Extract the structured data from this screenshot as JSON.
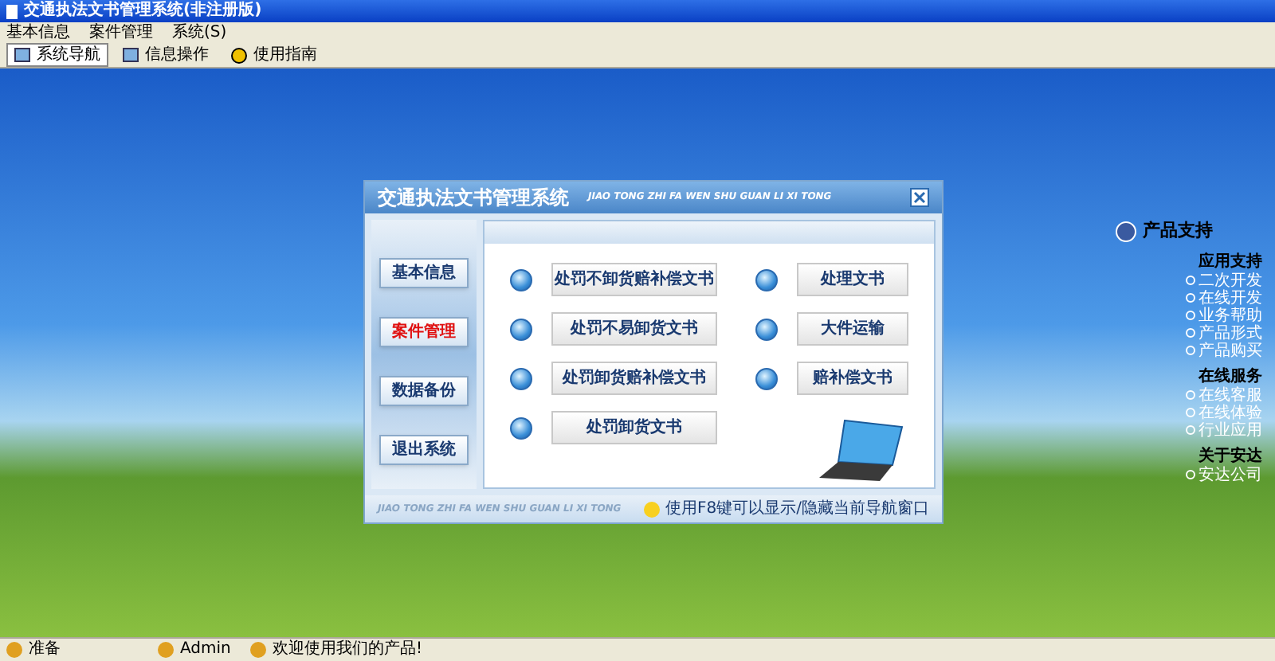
{
  "window": {
    "title": "交通执法文书管理系统(非注册版)"
  },
  "menu": [
    "基本信息",
    "案件管理",
    "系统(S)"
  ],
  "toolbar": [
    {
      "label": "系统导航",
      "selected": true
    },
    {
      "label": "信息操作",
      "selected": false
    },
    {
      "label": "使用指南",
      "selected": false
    }
  ],
  "dialog": {
    "title": "交通执法文书管理系统",
    "subtitle": "JIAO TONG ZHI FA WEN SHU GUAN LI XI TONG",
    "nav": [
      {
        "label": "基本信息",
        "selected": false
      },
      {
        "label": "案件管理",
        "selected": true
      },
      {
        "label": "数据备份",
        "selected": false
      },
      {
        "label": "退出系统",
        "selected": false
      }
    ],
    "left_buttons": [
      "处罚不卸货赔补偿文书",
      "处罚不易卸货文书",
      "处罚卸货赔补偿文书",
      "处罚卸货文书"
    ],
    "right_buttons": [
      "处理文书",
      "大件运输",
      "赔补偿文书"
    ],
    "footer_text": "JIAO TONG ZHI FA WEN SHU GUAN LI XI TONG",
    "hint": "使用F8键可以显示/隐藏当前导航窗口"
  },
  "support": {
    "title": "产品支持",
    "sections": [
      {
        "heading": "应用支持",
        "items": [
          "二次开发",
          "在线开发",
          "业务帮助",
          "产品形式",
          "产品购买"
        ]
      },
      {
        "heading": "在线服务",
        "items": [
          "在线客服",
          "在线体验",
          "行业应用"
        ]
      },
      {
        "heading": "关于安达",
        "items": [
          "安达公司"
        ]
      }
    ]
  },
  "status_bar": [
    "准备",
    "Admin",
    "欢迎使用我们的产品!"
  ]
}
